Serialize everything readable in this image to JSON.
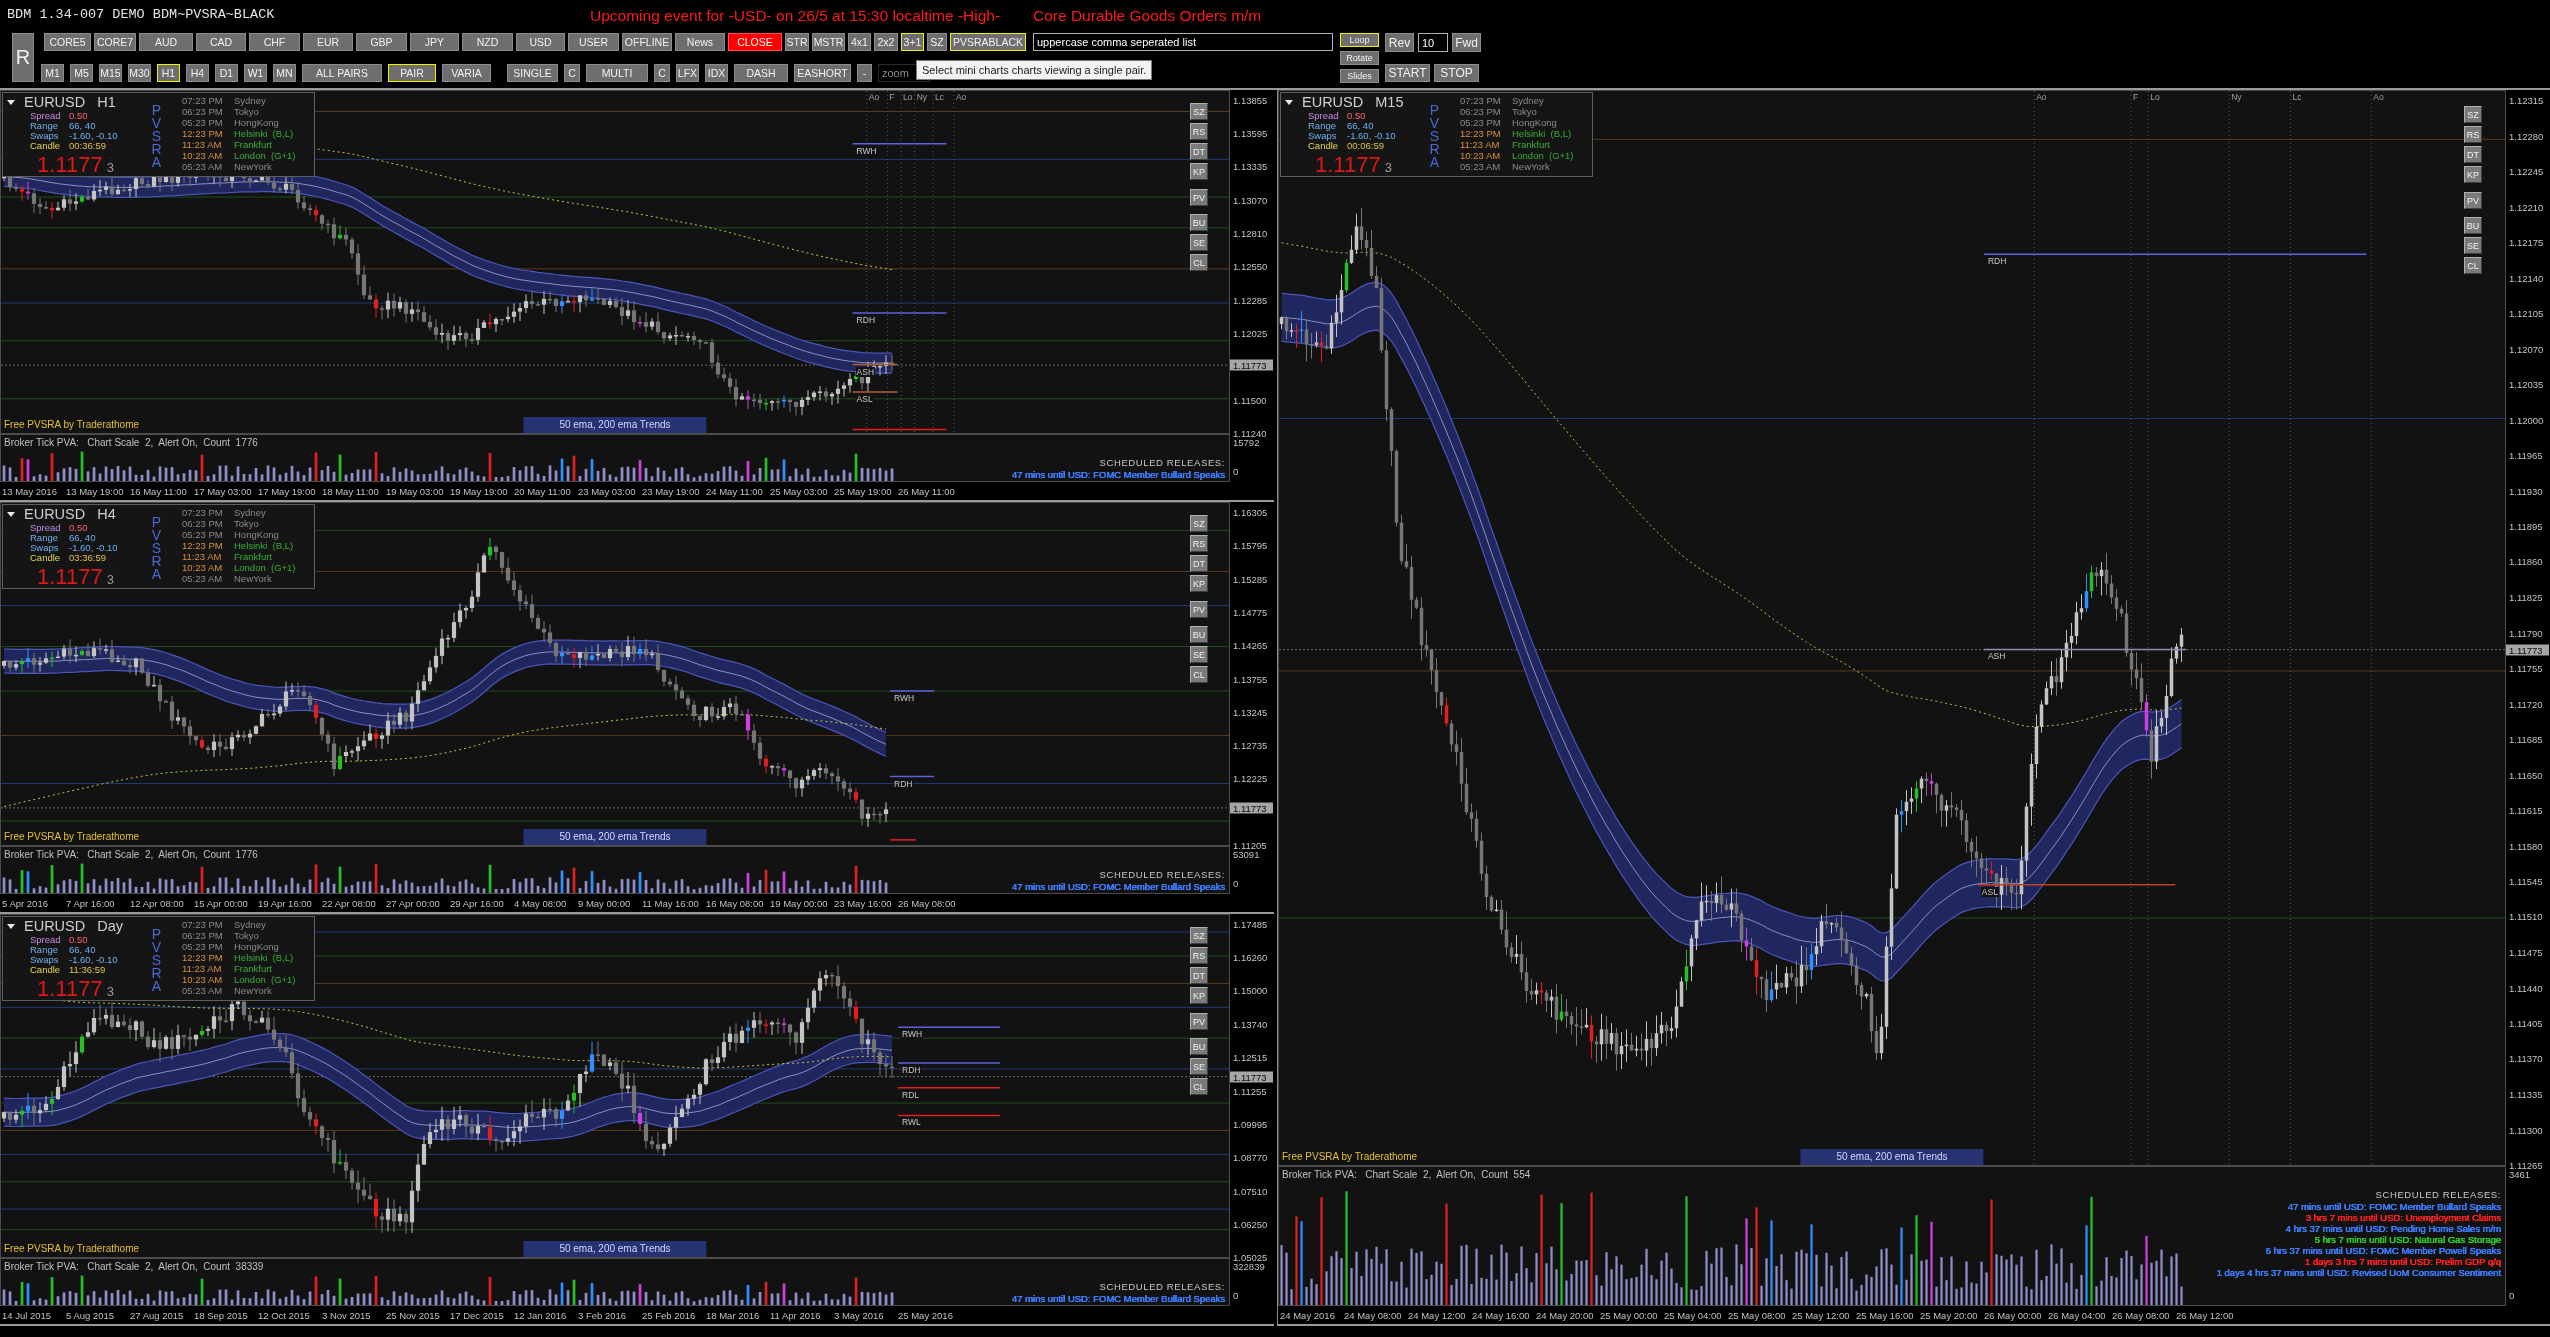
{
  "header": {
    "title": "BDM 1.34-007 DEMO BDM~PVSRA~BLACK",
    "event_alert": "Upcoming event for -USD- on 26/5 at 15:30 localtime -High-",
    "event_name": "Core Durable Goods Orders m/m"
  },
  "toolbar": {
    "big_button": {
      "label": "R"
    },
    "row_1": [
      {
        "label": "CORE5",
        "kind": "button",
        "selected": false
      },
      {
        "label": "CORE7",
        "kind": "button",
        "selected": false
      },
      {
        "label": "AUD",
        "kind": "button",
        "selected": false
      },
      {
        "label": "CAD",
        "kind": "button",
        "selected": false
      },
      {
        "label": "CHF",
        "kind": "button",
        "selected": false
      },
      {
        "label": "EUR",
        "kind": "button",
        "selected": false
      },
      {
        "label": "GBP",
        "kind": "button",
        "selected": false
      },
      {
        "label": "JPY",
        "kind": "button",
        "selected": false
      },
      {
        "label": "NZD",
        "kind": "button",
        "selected": false
      },
      {
        "label": "USD",
        "kind": "button",
        "selected": false
      },
      {
        "label": "USER",
        "kind": "button",
        "selected": false
      },
      {
        "label": "OFFLINE",
        "kind": "button",
        "selected": false
      },
      {
        "label": "News",
        "kind": "button",
        "selected": false
      },
      {
        "label": "CLOSE",
        "kind": "alert",
        "selected": false
      },
      {
        "label": "STR",
        "kind": "button",
        "selected": false
      },
      {
        "label": "MSTR",
        "kind": "button",
        "selected": false
      },
      {
        "label": "4x1",
        "kind": "button",
        "selected": false
      },
      {
        "label": "2x2",
        "kind": "button",
        "selected": false
      },
      {
        "label": "3+1",
        "kind": "button",
        "selected": true
      },
      {
        "label": "SZ",
        "kind": "button",
        "selected": false
      },
      {
        "label": "PVSRABLACK",
        "kind": "button",
        "selected": true
      }
    ],
    "symbols_field": {
      "value": "uppercase comma seperated list"
    },
    "row_2": [
      {
        "label": "M1",
        "selected": false
      },
      {
        "label": "M5",
        "selected": false
      },
      {
        "label": "M15",
        "selected": false
      },
      {
        "label": "M30",
        "selected": false
      },
      {
        "label": "H1",
        "selected": true
      },
      {
        "label": "H4",
        "selected": false
      },
      {
        "label": "D1",
        "selected": false
      },
      {
        "label": "W1",
        "selected": false
      },
      {
        "label": "MN",
        "selected": false
      },
      {
        "label": "ALL PAIRS",
        "selected": false
      },
      {
        "label": "PAIR",
        "selected": true
      },
      {
        "label": "VARIA",
        "selected": false
      },
      {
        "label": "SINGLE",
        "selected": false
      },
      {
        "label": "C",
        "selected": false
      },
      {
        "label": "MULTI",
        "selected": false
      },
      {
        "label": "C",
        "selected": false
      },
      {
        "label": "LFX",
        "selected": false
      },
      {
        "label": "IDX",
        "selected": false
      },
      {
        "label": "DASH",
        "selected": false
      },
      {
        "label": "EASHORT",
        "selected": false
      },
      {
        "label": "-",
        "selected": false
      }
    ],
    "zoom_field": {
      "placeholder": "zoom"
    },
    "tooltip": "Select mini charts charts viewing a single pair.",
    "slideshow_buttons": [
      {
        "label": "Loop",
        "selected": true
      },
      {
        "label": "Rotate",
        "selected": false
      },
      {
        "label": "Slides",
        "selected": false
      }
    ],
    "rev_button": "Rev",
    "step_field": {
      "value": "10"
    },
    "fwd_button": "Fwd",
    "start_button": "START",
    "stop_button": "STOP"
  },
  "charts": [
    {
      "symbol": "EURUSD",
      "timeframe": "H1",
      "info": {
        "stats": [
          {
            "label": "Spread",
            "value": "0.50"
          },
          {
            "label": "Range",
            "value": "66, 40"
          },
          {
            "label": "Swaps",
            "value": "-1.60, -0.10"
          },
          {
            "label": "Candle",
            "value": "00:36:59"
          }
        ],
        "price": "1.1177",
        "price_tail": "3",
        "indicator": "PVSRA",
        "clocks": [
          {
            "time": "07:23 PM",
            "city": "Sydney",
            "open": false
          },
          {
            "time": "06:23 PM",
            "city": "Tokyo",
            "open": false
          },
          {
            "time": "05:23 PM",
            "city": "HongKong",
            "open": false
          },
          {
            "time": "12:23 PM",
            "city": "Helsinki  (B,L)",
            "open": true
          },
          {
            "time": "11:23 AM",
            "city": "Frankfurt",
            "open": true
          },
          {
            "time": "10:23 AM",
            "city": "London  (G+1)",
            "open": true
          },
          {
            "time": "05:23 AM",
            "city": "NewYork",
            "open": false
          }
        ]
      },
      "side_buttons": [
        "SZ",
        "RS",
        "DT",
        "KP",
        "PV",
        "BU",
        "SE",
        "CL"
      ],
      "session_markers": [
        "Ao",
        "F",
        "Lo",
        "Ny",
        "Lc",
        "Ao"
      ],
      "levels": [
        "RWH",
        "RDH",
        "ASH",
        "ASL"
      ],
      "credit": "Free PVSRA by Traderathome",
      "legend": "50 ema, 200 ema Trends",
      "price_axis": [
        {
          "label": "1.13855",
          "kind": "tick"
        },
        {
          "label": "1.13595",
          "kind": "tick"
        },
        {
          "label": "1.13335",
          "kind": "tick"
        },
        {
          "label": "1.13070",
          "kind": "tick"
        },
        {
          "label": "1.12810",
          "kind": "tick"
        },
        {
          "label": "1.12550",
          "kind": "tick"
        },
        {
          "label": "1.12285",
          "kind": "tick"
        },
        {
          "label": "1.12025",
          "kind": "tick"
        },
        {
          "label": "1.11773",
          "kind": "current"
        },
        {
          "label": "1.11500",
          "kind": "tick"
        },
        {
          "label": "1.11240",
          "kind": "tick"
        }
      ],
      "volume": {
        "header": "Broker Tick PVA:   Chart Scale  2,  Alert On,  Count  1776",
        "max_label": "15792",
        "min_label": "0",
        "releases_title": "SCHEDULED RELEASES:",
        "releases": [
          {
            "text": "47 mins until USD: FOMC Member Bullard Speaks",
            "color": "#3d7dff"
          }
        ]
      },
      "time_axis": [
        "13 May 2016",
        "13 May 19:00",
        "16 May 11:00",
        "17 May 03:00",
        "17 May 19:00",
        "18 May 11:00",
        "19 May 03:00",
        "19 May 19:00",
        "20 May 11:00",
        "23 May 03:00",
        "23 May 19:00",
        "24 May 11:00",
        "25 May 03:00",
        "25 May 19:00",
        "26 May 11:00"
      ]
    },
    {
      "symbol": "EURUSD",
      "timeframe": "H4",
      "info": {
        "stats": [
          {
            "label": "Spread",
            "value": "0.50"
          },
          {
            "label": "Range",
            "value": "66, 40"
          },
          {
            "label": "Swaps",
            "value": "-1.60, -0.10"
          },
          {
            "label": "Candle",
            "value": "03:36:59"
          }
        ],
        "price": "1.1177",
        "price_tail": "3",
        "indicator": "PVSRA",
        "clocks": [
          {
            "time": "07:23 PM",
            "city": "Sydney",
            "open": false
          },
          {
            "time": "06:23 PM",
            "city": "Tokyo",
            "open": false
          },
          {
            "time": "05:23 PM",
            "city": "HongKong",
            "open": false
          },
          {
            "time": "12:23 PM",
            "city": "Helsinki  (B,L)",
            "open": true
          },
          {
            "time": "11:23 AM",
            "city": "Frankfurt",
            "open": true
          },
          {
            "time": "10:23 AM",
            "city": "London  (G+1)",
            "open": true
          },
          {
            "time": "05:23 AM",
            "city": "NewYork",
            "open": false
          }
        ]
      },
      "side_buttons": [
        "SZ",
        "RS",
        "DT",
        "KP",
        "PV",
        "BU",
        "SE",
        "CL"
      ],
      "levels": [
        "RWH",
        "RDH"
      ],
      "credit": "Free PVSRA by Traderathome",
      "legend": "50 ema, 200 ema Trends",
      "price_axis": [
        {
          "label": "1.16305",
          "kind": "tick"
        },
        {
          "label": "1.15795",
          "kind": "tick"
        },
        {
          "label": "1.15285",
          "kind": "tick"
        },
        {
          "label": "1.14775",
          "kind": "tick"
        },
        {
          "label": "1.14265",
          "kind": "tick"
        },
        {
          "label": "1.13755",
          "kind": "tick"
        },
        {
          "label": "1.13245",
          "kind": "tick"
        },
        {
          "label": "1.12735",
          "kind": "tick"
        },
        {
          "label": "1.12225",
          "kind": "tick"
        },
        {
          "label": "1.11773",
          "kind": "current"
        },
        {
          "label": "1.11205",
          "kind": "tick"
        }
      ],
      "volume": {
        "header": "Broker Tick PVA:   Chart Scale  2,  Alert On,  Count  1776",
        "max_label": "53091",
        "min_label": "0",
        "releases_title": "SCHEDULED RELEASES:",
        "releases": [
          {
            "text": "47 mins until USD: FOMC Member Bullard Speaks",
            "color": "#3d7dff"
          }
        ]
      },
      "time_axis": [
        "5 Apr 2016",
        "7 Apr 16:00",
        "12 Apr 08:00",
        "15 Apr 00:00",
        "19 Apr 16:00",
        "22 Apr 08:00",
        "27 Apr 00:00",
        "29 Apr 16:00",
        "4 May 08:00",
        "9 May 00:00",
        "11 May 16:00",
        "16 May 08:00",
        "19 May 00:00",
        "23 May 16:00",
        "26 May 08:00"
      ]
    },
    {
      "symbol": "EURUSD",
      "timeframe": "Day",
      "info": {
        "stats": [
          {
            "label": "Spread",
            "value": "0.50"
          },
          {
            "label": "Range",
            "value": "66, 40"
          },
          {
            "label": "Swaps",
            "value": "-1.60, -0.10"
          },
          {
            "label": "Candle",
            "value": "11:36:59"
          }
        ],
        "price": "1.1177",
        "price_tail": "3",
        "indicator": "PVSRA",
        "clocks": [
          {
            "time": "07:23 PM",
            "city": "Sydney",
            "open": false
          },
          {
            "time": "06:23 PM",
            "city": "Tokyo",
            "open": false
          },
          {
            "time": "05:23 PM",
            "city": "HongKong",
            "open": false
          },
          {
            "time": "12:23 PM",
            "city": "Helsinki  (B,L)",
            "open": true
          },
          {
            "time": "11:23 AM",
            "city": "Frankfurt",
            "open": true
          },
          {
            "time": "10:23 AM",
            "city": "London  (G+1)",
            "open": true
          },
          {
            "time": "05:23 AM",
            "city": "NewYork",
            "open": false
          }
        ]
      },
      "side_buttons": [
        "SZ",
        "RS",
        "DT",
        "KP",
        "PV",
        "BU",
        "SE",
        "CL"
      ],
      "levels": [
        "RWH",
        "RDH",
        "RDL",
        "RWL"
      ],
      "credit": "Free PVSRA by Traderathome",
      "legend": "50 ema, 200 ema Trends",
      "price_axis": [
        {
          "label": "1.17485",
          "kind": "tick"
        },
        {
          "label": "1.16260",
          "kind": "tick"
        },
        {
          "label": "1.15000",
          "kind": "tick"
        },
        {
          "label": "1.13740",
          "kind": "tick"
        },
        {
          "label": "1.12515",
          "kind": "tick"
        },
        {
          "label": "1.11773",
          "kind": "current"
        },
        {
          "label": "1.11255",
          "kind": "tick"
        },
        {
          "label": "1.09995",
          "kind": "tick"
        },
        {
          "label": "1.08770",
          "kind": "tick"
        },
        {
          "label": "1.07510",
          "kind": "tick"
        },
        {
          "label": "1.06250",
          "kind": "tick"
        },
        {
          "label": "1.05025",
          "kind": "tick"
        }
      ],
      "volume": {
        "header": "Broker Tick PVA:   Chart Scale  2,  Alert On,  Count  38339",
        "max_label": "322839",
        "min_label": "0",
        "releases_title": "SCHEDULED RELEASES:",
        "releases": [
          {
            "text": "47 mins until USD: FOMC Member Bullard Speaks",
            "color": "#3d7dff"
          }
        ]
      },
      "time_axis": [
        "14 Jul 2015",
        "5 Aug 2015",
        "27 Aug 2015",
        "18 Sep 2015",
        "12 Oct 2015",
        "3 Nov 2015",
        "25 Nov 2015",
        "17 Dec 2015",
        "12 Jan 2016",
        "3 Feb 2016",
        "25 Feb 2016",
        "18 Mar 2016",
        "11 Apr 2016",
        "3 May 2016",
        "25 May 2016"
      ]
    },
    {
      "symbol": "EURUSD",
      "timeframe": "M15",
      "info": {
        "stats": [
          {
            "label": "Spread",
            "value": "0.50"
          },
          {
            "label": "Range",
            "value": "66, 40"
          },
          {
            "label": "Swaps",
            "value": "-1.60, -0.10"
          },
          {
            "label": "Candle",
            "value": "00:06:59"
          }
        ],
        "price": "1.1177",
        "price_tail": "3",
        "indicator": "PVSRA",
        "clocks": [
          {
            "time": "07:23 PM",
            "city": "Sydney",
            "open": false
          },
          {
            "time": "06:23 PM",
            "city": "Tokyo",
            "open": false
          },
          {
            "time": "05:23 PM",
            "city": "HongKong",
            "open": false
          },
          {
            "time": "12:23 PM",
            "city": "Helsinki  (B,L)",
            "open": true
          },
          {
            "time": "11:23 AM",
            "city": "Frankfurt",
            "open": true
          },
          {
            "time": "10:23 AM",
            "city": "London  (G+1)",
            "open": true
          },
          {
            "time": "05:23 AM",
            "city": "NewYork",
            "open": false
          }
        ]
      },
      "side_buttons": [
        "SZ",
        "RS",
        "DT",
        "KP",
        "PV",
        "BU",
        "SE",
        "CL"
      ],
      "session_markers": [
        "Ao",
        "F",
        "Lo",
        "Ny",
        "Lc",
        "Ao"
      ],
      "levels": [
        "RDH",
        "ASH",
        "ASL"
      ],
      "credit": "Free PVSRA by Traderathome",
      "legend": "50 ema, 200 ema Trends",
      "price_axis": [
        {
          "label": "1.12315",
          "kind": "tick"
        },
        {
          "label": "1.12280",
          "kind": "tick"
        },
        {
          "label": "1.12245",
          "kind": "tick"
        },
        {
          "label": "1.12210",
          "kind": "tick"
        },
        {
          "label": "1.12175",
          "kind": "tick"
        },
        {
          "label": "1.12140",
          "kind": "tick"
        },
        {
          "label": "1.12105",
          "kind": "tick"
        },
        {
          "label": "1.12070",
          "kind": "tick"
        },
        {
          "label": "1.12035",
          "kind": "tick"
        },
        {
          "label": "1.12000",
          "kind": "tick"
        },
        {
          "label": "1.11965",
          "kind": "tick"
        },
        {
          "label": "1.11930",
          "kind": "tick"
        },
        {
          "label": "1.11895",
          "kind": "tick"
        },
        {
          "label": "1.11860",
          "kind": "tick"
        },
        {
          "label": "1.11825",
          "kind": "tick"
        },
        {
          "label": "1.11790",
          "kind": "tick"
        },
        {
          "label": "1.11773",
          "kind": "current"
        },
        {
          "label": "1.11755",
          "kind": "tick"
        },
        {
          "label": "1.11720",
          "kind": "tick"
        },
        {
          "label": "1.11685",
          "kind": "tick"
        },
        {
          "label": "1.11650",
          "kind": "tick"
        },
        {
          "label": "1.11615",
          "kind": "tick"
        },
        {
          "label": "1.11580",
          "kind": "tick"
        },
        {
          "label": "1.11545",
          "kind": "tick"
        },
        {
          "label": "1.11510",
          "kind": "tick"
        },
        {
          "label": "1.11475",
          "kind": "tick"
        },
        {
          "label": "1.11440",
          "kind": "tick"
        },
        {
          "label": "1.11405",
          "kind": "tick"
        },
        {
          "label": "1.11370",
          "kind": "tick"
        },
        {
          "label": "1.11335",
          "kind": "tick"
        },
        {
          "label": "1.11300",
          "kind": "tick"
        },
        {
          "label": "1.11265",
          "kind": "tick"
        }
      ],
      "volume": {
        "header": "Broker Tick PVA:   Chart Scale  2,  Alert On,  Count  554",
        "max_label": "3461",
        "min_label": "0",
        "releases_title": "SCHEDULED RELEASES:",
        "releases": [
          {
            "text": "47 mins until USD: FOMC Member Bullard Speaks",
            "color": "#3d7dff"
          },
          {
            "text": "3 hrs 7 mins until USD: Unemployment Claims",
            "color": "#ff2020"
          },
          {
            "text": "4 hrs 37 mins until USD: Pending Home Sales m/m",
            "color": "#3d7dff"
          },
          {
            "text": "5 hrs 7 mins until USD: Natural Gas Storage",
            "color": "#2ec82e"
          },
          {
            "text": "6 hrs 37 mins until USD: FOMC Member Powell Speaks",
            "color": "#3d7dff"
          },
          {
            "text": "1 days 3 hrs 7 mins until USD: Prelim GDP q/q",
            "color": "#ff2020"
          },
          {
            "text": "1 days 4 hrs 37 mins until USD: Revised UoM Consumer Sentiment",
            "color": "#3d7dff"
          }
        ]
      },
      "time_axis": [
        "24 May 2016",
        "24 May 08:00",
        "24 May 12:00",
        "24 May 16:00",
        "24 May 20:00",
        "25 May 00:00",
        "25 May 04:00",
        "25 May 08:00",
        "25 May 12:00",
        "25 May 16:00",
        "25 May 20:00",
        "26 May 00:00",
        "26 May 04:00",
        "26 May 08:00",
        "26 May 12:00"
      ]
    }
  ]
}
